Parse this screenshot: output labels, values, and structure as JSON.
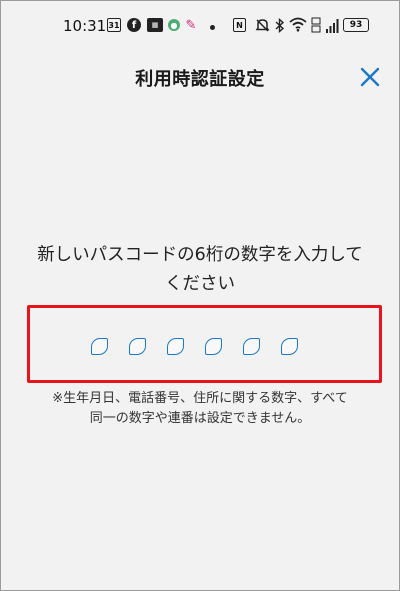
{
  "status_bar": {
    "time": "10:31",
    "calendar_day": "31",
    "battery_level": "93",
    "icons": [
      "calendar-icon",
      "facebook-icon",
      "news-icon",
      "green-app-icon",
      "pink-app-icon",
      "dot-icon",
      "nfc-icon",
      "mute-icon",
      "bluetooth-icon",
      "wifi-icon",
      "volte-icon",
      "signal-icon",
      "battery-icon"
    ]
  },
  "header": {
    "title": "利用時認証設定",
    "close_icon": "close-icon",
    "accent_color": "#1b78c8"
  },
  "prompt": {
    "line1": "新しいパスコードの6桁の数字を入力して",
    "line2": "ください"
  },
  "passcode": {
    "length": 6,
    "digits": [
      "",
      "",
      "",
      "",
      "",
      ""
    ],
    "highlight_color": "#e8141c"
  },
  "note": {
    "line1": "※生年月日、電話番号、住所に関する数字、すべて",
    "line2": "同一の数字や連番は設定できません。"
  }
}
